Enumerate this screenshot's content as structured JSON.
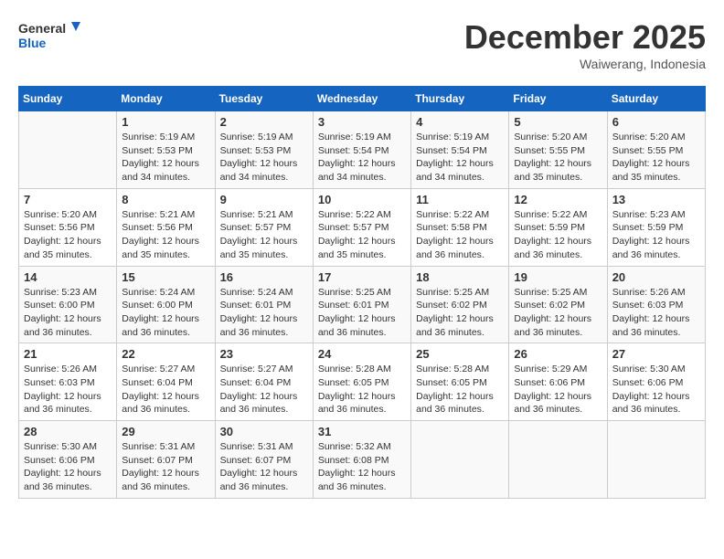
{
  "header": {
    "logo_line1": "General",
    "logo_line2": "Blue",
    "month": "December 2025",
    "location": "Waiwerang, Indonesia"
  },
  "days_of_week": [
    "Sunday",
    "Monday",
    "Tuesday",
    "Wednesday",
    "Thursday",
    "Friday",
    "Saturday"
  ],
  "weeks": [
    [
      {
        "day": "",
        "sunrise": "",
        "sunset": "",
        "daylight": ""
      },
      {
        "day": "1",
        "sunrise": "Sunrise: 5:19 AM",
        "sunset": "Sunset: 5:53 PM",
        "daylight": "Daylight: 12 hours and 34 minutes."
      },
      {
        "day": "2",
        "sunrise": "Sunrise: 5:19 AM",
        "sunset": "Sunset: 5:53 PM",
        "daylight": "Daylight: 12 hours and 34 minutes."
      },
      {
        "day": "3",
        "sunrise": "Sunrise: 5:19 AM",
        "sunset": "Sunset: 5:54 PM",
        "daylight": "Daylight: 12 hours and 34 minutes."
      },
      {
        "day": "4",
        "sunrise": "Sunrise: 5:19 AM",
        "sunset": "Sunset: 5:54 PM",
        "daylight": "Daylight: 12 hours and 34 minutes."
      },
      {
        "day": "5",
        "sunrise": "Sunrise: 5:20 AM",
        "sunset": "Sunset: 5:55 PM",
        "daylight": "Daylight: 12 hours and 35 minutes."
      },
      {
        "day": "6",
        "sunrise": "Sunrise: 5:20 AM",
        "sunset": "Sunset: 5:55 PM",
        "daylight": "Daylight: 12 hours and 35 minutes."
      }
    ],
    [
      {
        "day": "7",
        "sunrise": "Sunrise: 5:20 AM",
        "sunset": "Sunset: 5:56 PM",
        "daylight": "Daylight: 12 hours and 35 minutes."
      },
      {
        "day": "8",
        "sunrise": "Sunrise: 5:21 AM",
        "sunset": "Sunset: 5:56 PM",
        "daylight": "Daylight: 12 hours and 35 minutes."
      },
      {
        "day": "9",
        "sunrise": "Sunrise: 5:21 AM",
        "sunset": "Sunset: 5:57 PM",
        "daylight": "Daylight: 12 hours and 35 minutes."
      },
      {
        "day": "10",
        "sunrise": "Sunrise: 5:22 AM",
        "sunset": "Sunset: 5:57 PM",
        "daylight": "Daylight: 12 hours and 35 minutes."
      },
      {
        "day": "11",
        "sunrise": "Sunrise: 5:22 AM",
        "sunset": "Sunset: 5:58 PM",
        "daylight": "Daylight: 12 hours and 36 minutes."
      },
      {
        "day": "12",
        "sunrise": "Sunrise: 5:22 AM",
        "sunset": "Sunset: 5:59 PM",
        "daylight": "Daylight: 12 hours and 36 minutes."
      },
      {
        "day": "13",
        "sunrise": "Sunrise: 5:23 AM",
        "sunset": "Sunset: 5:59 PM",
        "daylight": "Daylight: 12 hours and 36 minutes."
      }
    ],
    [
      {
        "day": "14",
        "sunrise": "Sunrise: 5:23 AM",
        "sunset": "Sunset: 6:00 PM",
        "daylight": "Daylight: 12 hours and 36 minutes."
      },
      {
        "day": "15",
        "sunrise": "Sunrise: 5:24 AM",
        "sunset": "Sunset: 6:00 PM",
        "daylight": "Daylight: 12 hours and 36 minutes."
      },
      {
        "day": "16",
        "sunrise": "Sunrise: 5:24 AM",
        "sunset": "Sunset: 6:01 PM",
        "daylight": "Daylight: 12 hours and 36 minutes."
      },
      {
        "day": "17",
        "sunrise": "Sunrise: 5:25 AM",
        "sunset": "Sunset: 6:01 PM",
        "daylight": "Daylight: 12 hours and 36 minutes."
      },
      {
        "day": "18",
        "sunrise": "Sunrise: 5:25 AM",
        "sunset": "Sunset: 6:02 PM",
        "daylight": "Daylight: 12 hours and 36 minutes."
      },
      {
        "day": "19",
        "sunrise": "Sunrise: 5:25 AM",
        "sunset": "Sunset: 6:02 PM",
        "daylight": "Daylight: 12 hours and 36 minutes."
      },
      {
        "day": "20",
        "sunrise": "Sunrise: 5:26 AM",
        "sunset": "Sunset: 6:03 PM",
        "daylight": "Daylight: 12 hours and 36 minutes."
      }
    ],
    [
      {
        "day": "21",
        "sunrise": "Sunrise: 5:26 AM",
        "sunset": "Sunset: 6:03 PM",
        "daylight": "Daylight: 12 hours and 36 minutes."
      },
      {
        "day": "22",
        "sunrise": "Sunrise: 5:27 AM",
        "sunset": "Sunset: 6:04 PM",
        "daylight": "Daylight: 12 hours and 36 minutes."
      },
      {
        "day": "23",
        "sunrise": "Sunrise: 5:27 AM",
        "sunset": "Sunset: 6:04 PM",
        "daylight": "Daylight: 12 hours and 36 minutes."
      },
      {
        "day": "24",
        "sunrise": "Sunrise: 5:28 AM",
        "sunset": "Sunset: 6:05 PM",
        "daylight": "Daylight: 12 hours and 36 minutes."
      },
      {
        "day": "25",
        "sunrise": "Sunrise: 5:28 AM",
        "sunset": "Sunset: 6:05 PM",
        "daylight": "Daylight: 12 hours and 36 minutes."
      },
      {
        "day": "26",
        "sunrise": "Sunrise: 5:29 AM",
        "sunset": "Sunset: 6:06 PM",
        "daylight": "Daylight: 12 hours and 36 minutes."
      },
      {
        "day": "27",
        "sunrise": "Sunrise: 5:30 AM",
        "sunset": "Sunset: 6:06 PM",
        "daylight": "Daylight: 12 hours and 36 minutes."
      }
    ],
    [
      {
        "day": "28",
        "sunrise": "Sunrise: 5:30 AM",
        "sunset": "Sunset: 6:06 PM",
        "daylight": "Daylight: 12 hours and 36 minutes."
      },
      {
        "day": "29",
        "sunrise": "Sunrise: 5:31 AM",
        "sunset": "Sunset: 6:07 PM",
        "daylight": "Daylight: 12 hours and 36 minutes."
      },
      {
        "day": "30",
        "sunrise": "Sunrise: 5:31 AM",
        "sunset": "Sunset: 6:07 PM",
        "daylight": "Daylight: 12 hours and 36 minutes."
      },
      {
        "day": "31",
        "sunrise": "Sunrise: 5:32 AM",
        "sunset": "Sunset: 6:08 PM",
        "daylight": "Daylight: 12 hours and 36 minutes."
      },
      {
        "day": "",
        "sunrise": "",
        "sunset": "",
        "daylight": ""
      },
      {
        "day": "",
        "sunrise": "",
        "sunset": "",
        "daylight": ""
      },
      {
        "day": "",
        "sunrise": "",
        "sunset": "",
        "daylight": ""
      }
    ]
  ]
}
